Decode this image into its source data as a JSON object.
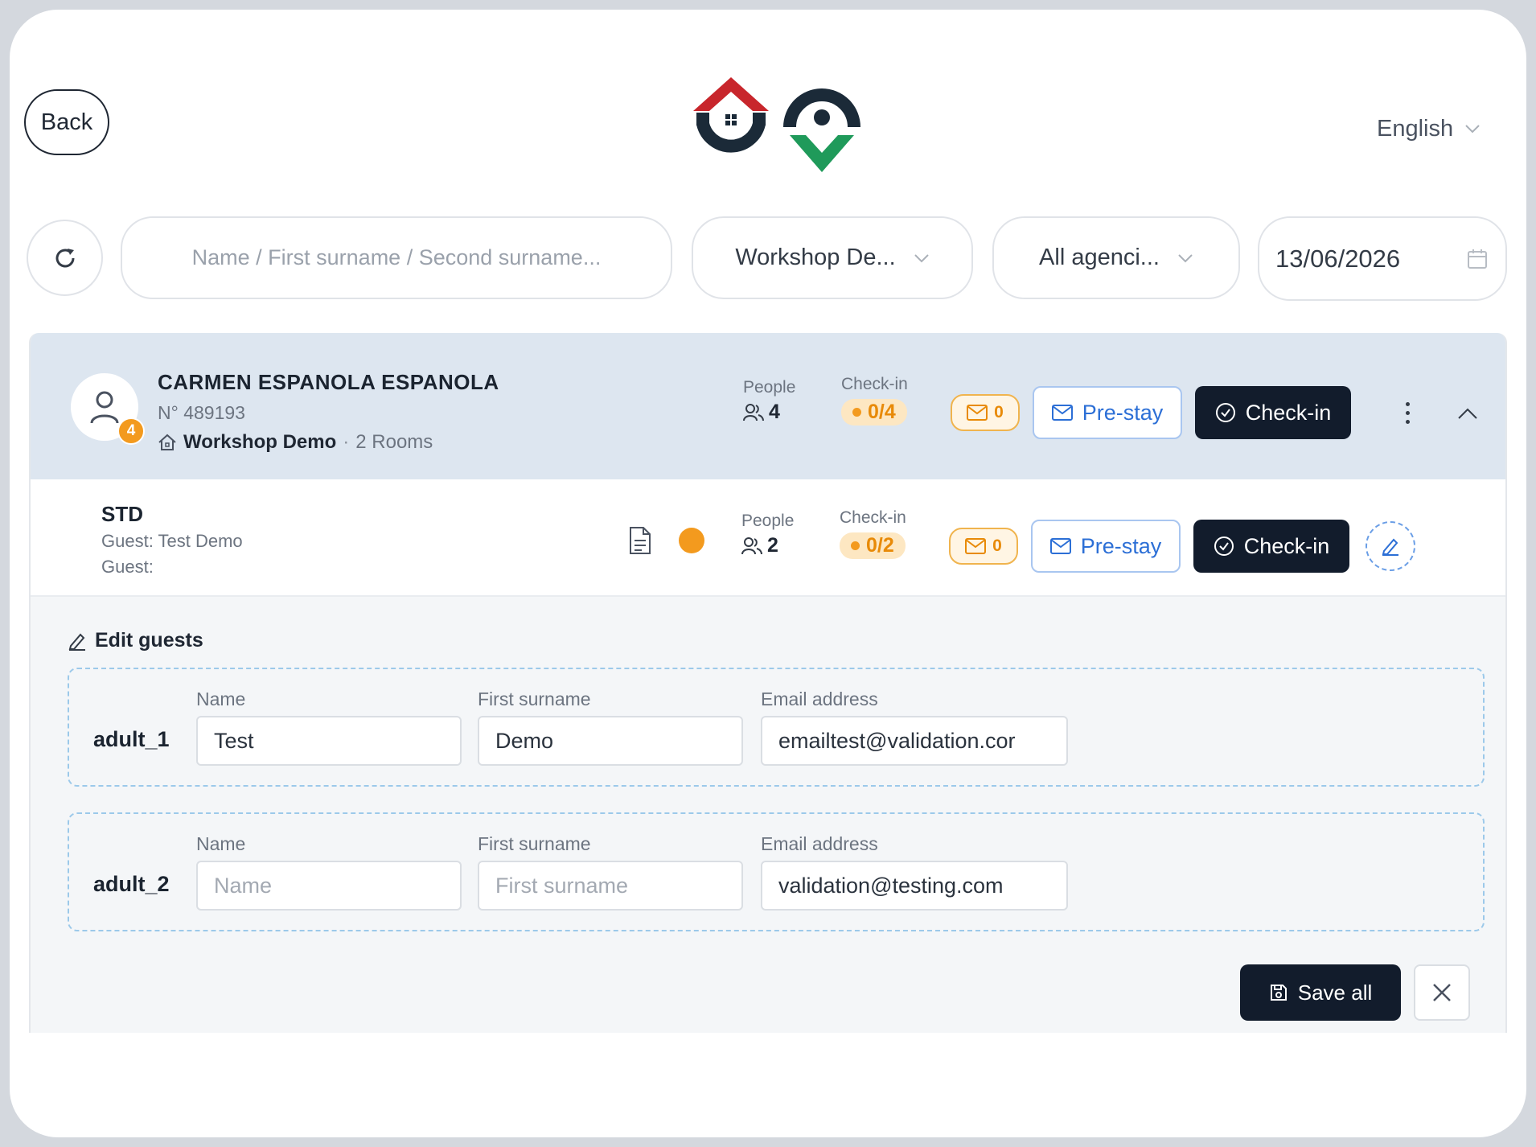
{
  "header": {
    "back_label": "Back",
    "language": "English"
  },
  "filters": {
    "search_placeholder": "Name / First surname / Second surname...",
    "hotel_selected": "Workshop De...",
    "agency_selected": "All agenci...",
    "date_value": "13/06/2026"
  },
  "reservation": {
    "guest_name": "CARMEN ESPANOLA ESPANOLA",
    "number": "N° 489193",
    "avatar_badge": "4",
    "hotel": "Workshop Demo",
    "separator": "·",
    "rooms": "2 Rooms",
    "people_label": "People",
    "people_count": "4",
    "checkin_label": "Check-in",
    "checkin_progress": "0/4",
    "mail_count": "0",
    "prestay_label": "Pre-stay",
    "checkin_button": "Check-in"
  },
  "room": {
    "type": "STD",
    "guest_line_1": "Guest: Test Demo",
    "guest_line_2": "Guest:",
    "people_label": "People",
    "people_count": "2",
    "checkin_label": "Check-in",
    "checkin_progress": "0/2",
    "mail_count": "0",
    "prestay_label": "Pre-stay",
    "checkin_button": "Check-in"
  },
  "edit_guests": {
    "title": "Edit guests",
    "guests": [
      {
        "label": "adult_1",
        "name_label": "Name",
        "name_value": "Test",
        "surname_label": "First surname",
        "surname_value": "Demo",
        "email_label": "Email address",
        "email_value": "emailtest@validation.cor"
      },
      {
        "label": "adult_2",
        "name_label": "Name",
        "name_placeholder": "Name",
        "surname_label": "First surname",
        "surname_placeholder": "First surname",
        "email_label": "Email address",
        "email_value": "validation@testing.com"
      }
    ],
    "save_label": "Save all"
  },
  "colors": {
    "accent_dark": "#121c2c",
    "accent_blue": "#2c6fd6",
    "status_orange": "#f39a1e",
    "logo_red": "#c8262c",
    "logo_green": "#1f9a5a",
    "logo_navy": "#1b2a38"
  },
  "icons": [
    "refresh-icon",
    "chevron-down-icon",
    "calendar-icon",
    "user-icon",
    "home-icon",
    "people-icon",
    "mail-icon",
    "check-circle-icon",
    "kebab-icon",
    "chevron-up-icon",
    "document-icon",
    "pencil-icon",
    "save-icon",
    "close-icon"
  ]
}
